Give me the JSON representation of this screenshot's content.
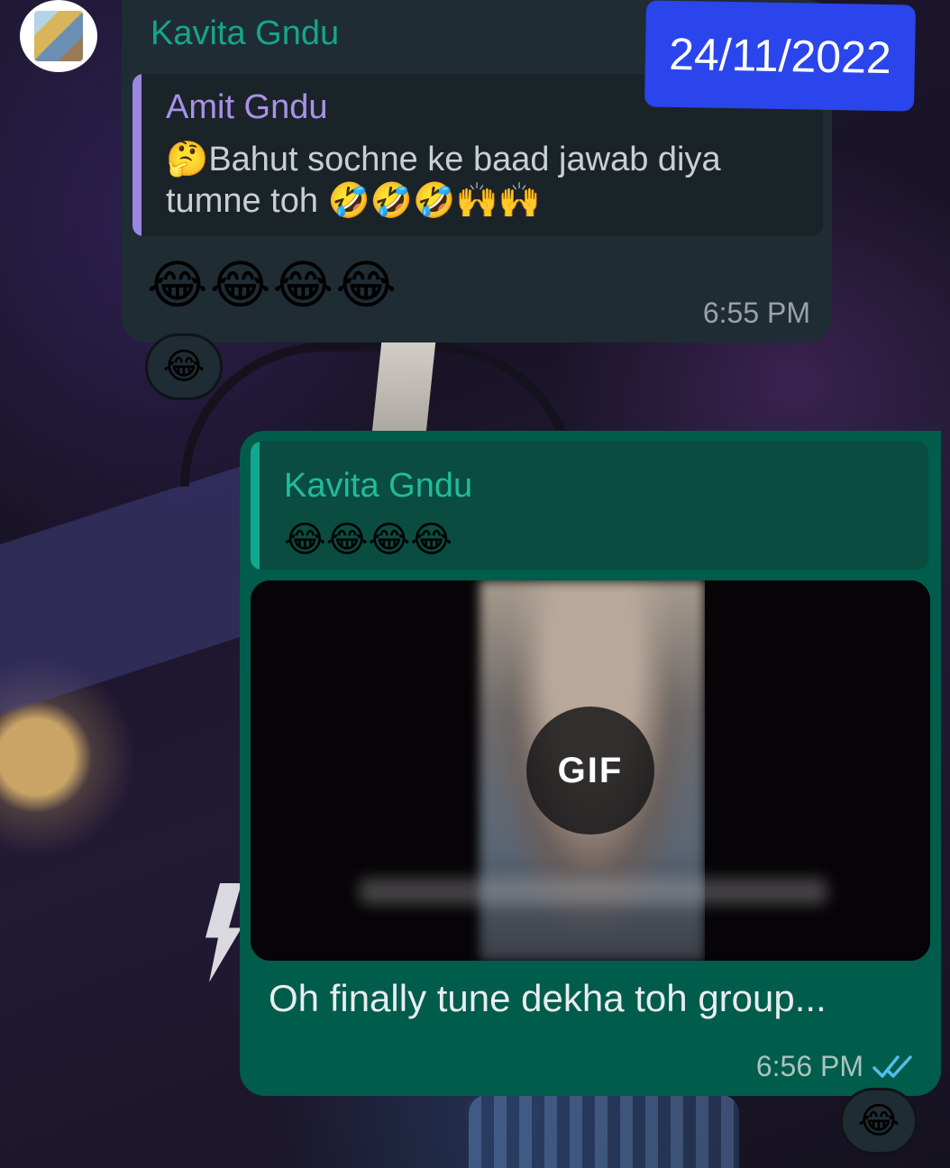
{
  "incoming": {
    "sender": "Kavita Gndu",
    "quote": {
      "author": "Amit Gndu",
      "text": "🤔Bahut sochne ke baad jawab diya tumne toh 🤣🤣🤣🙌🙌"
    },
    "message": "😂😂😂😂",
    "time": "6:55 PM",
    "reaction": "😂"
  },
  "date_badge": "24/11/2022",
  "outgoing": {
    "quote": {
      "author": "Kavita Gndu",
      "text": "😂😂😂😂"
    },
    "media": {
      "type_label": "GIF"
    },
    "message": "Oh finally tune dekha toh group...",
    "time": "6:56 PM",
    "status_icon": "double-check-icon",
    "reaction": "😂"
  },
  "colors": {
    "incoming_bubble": "#1f2c33",
    "outgoing_bubble": "#005c4b",
    "date_badge": "#2b45ec",
    "sender_name": "#15a58a",
    "quote_author_in": "#a991e8",
    "read_tick": "#53bdeb"
  }
}
